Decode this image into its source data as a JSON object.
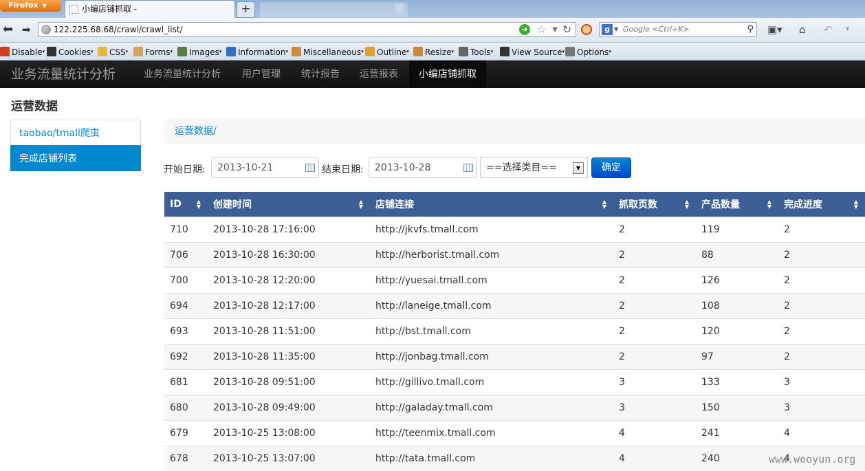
{
  "browser": {
    "menu_button": "Firefox",
    "tab_title": "小编店铺抓取 -",
    "new_tab_icon": "plus-icon",
    "url": "122.225.68.68/crawl/crawl_list/",
    "search_placeholder": "Google <Ctrl+K>",
    "devtools": [
      {
        "label": "Disable",
        "icon": "disable-icon",
        "color": "#d23b1f"
      },
      {
        "label": "Cookies",
        "icon": "cookies-icon",
        "color": "#333333"
      },
      {
        "label": "CSS",
        "icon": "css-icon",
        "color": "#e3b740"
      },
      {
        "label": "Forms",
        "icon": "forms-icon",
        "color": "#d7a25b"
      },
      {
        "label": "Images",
        "icon": "images-icon",
        "color": "#5c7a46"
      },
      {
        "label": "Information",
        "icon": "information-icon",
        "color": "#2f6fc4"
      },
      {
        "label": "Miscellaneous",
        "icon": "miscellaneous-icon",
        "color": "#d08a3b"
      },
      {
        "label": "Outline",
        "icon": "outline-icon",
        "color": "#e0a030"
      },
      {
        "label": "Resize",
        "icon": "resize-icon",
        "color": "#c98b3b"
      },
      {
        "label": "Tools",
        "icon": "tools-icon",
        "color": "#666666"
      },
      {
        "label": "View Source",
        "icon": "view-source-icon",
        "color": "#333333"
      },
      {
        "label": "Options",
        "icon": "options-icon",
        "color": "#777777"
      }
    ]
  },
  "appnav": {
    "brand": "业务流量统计分析",
    "links": [
      "业务流量统计分析",
      "用户管理",
      "统计报告",
      "运营报表",
      "小编店铺抓取"
    ],
    "active_index": 4
  },
  "sidebar": {
    "title": "运营数据",
    "items": [
      "taobao/tmall爬虫",
      "完成店铺列表"
    ],
    "active_index": 1
  },
  "breadcrumb": "运营数据/",
  "filter": {
    "start_label": "开始日期:",
    "start_value": "2013-10-21",
    "end_label": "结束日期:",
    "end_value": "2013-10-28",
    "category_selected": "==选择类目==",
    "submit": "确定"
  },
  "table": {
    "columns": [
      "ID",
      "创建时间",
      "店铺连接",
      "抓取页数",
      "产品数量",
      "完成进度"
    ],
    "rows": [
      [
        "710",
        "2013-10-28 17:16:00",
        "http://jkvfs.tmall.com",
        "2",
        "119",
        "2"
      ],
      [
        "706",
        "2013-10-28 16:30:00",
        "http://herborist.tmall.com",
        "2",
        "88",
        "2"
      ],
      [
        "700",
        "2013-10-28 12:20:00",
        "http://yuesai.tmall.com",
        "2",
        "126",
        "2"
      ],
      [
        "694",
        "2013-10-28 12:17:00",
        "http://laneige.tmall.com",
        "2",
        "108",
        "2"
      ],
      [
        "693",
        "2013-10-28 11:51:00",
        "http://bst.tmall.com",
        "2",
        "120",
        "2"
      ],
      [
        "692",
        "2013-10-28 11:35:00",
        "http://jonbag.tmall.com",
        "2",
        "97",
        "2"
      ],
      [
        "681",
        "2013-10-28 09:51:00",
        "http://gillivo.tmall.com",
        "3",
        "133",
        "3"
      ],
      [
        "680",
        "2013-10-28 09:49:00",
        "http://galaday.tmall.com",
        "3",
        "150",
        "3"
      ],
      [
        "679",
        "2013-10-25 13:08:00",
        "http://teenmix.tmall.com",
        "4",
        "241",
        "4"
      ],
      [
        "678",
        "2013-10-25 13:07:00",
        "http://tata.tmall.com",
        "4",
        "240",
        "4"
      ]
    ]
  },
  "watermark": "www.wooyun.org"
}
